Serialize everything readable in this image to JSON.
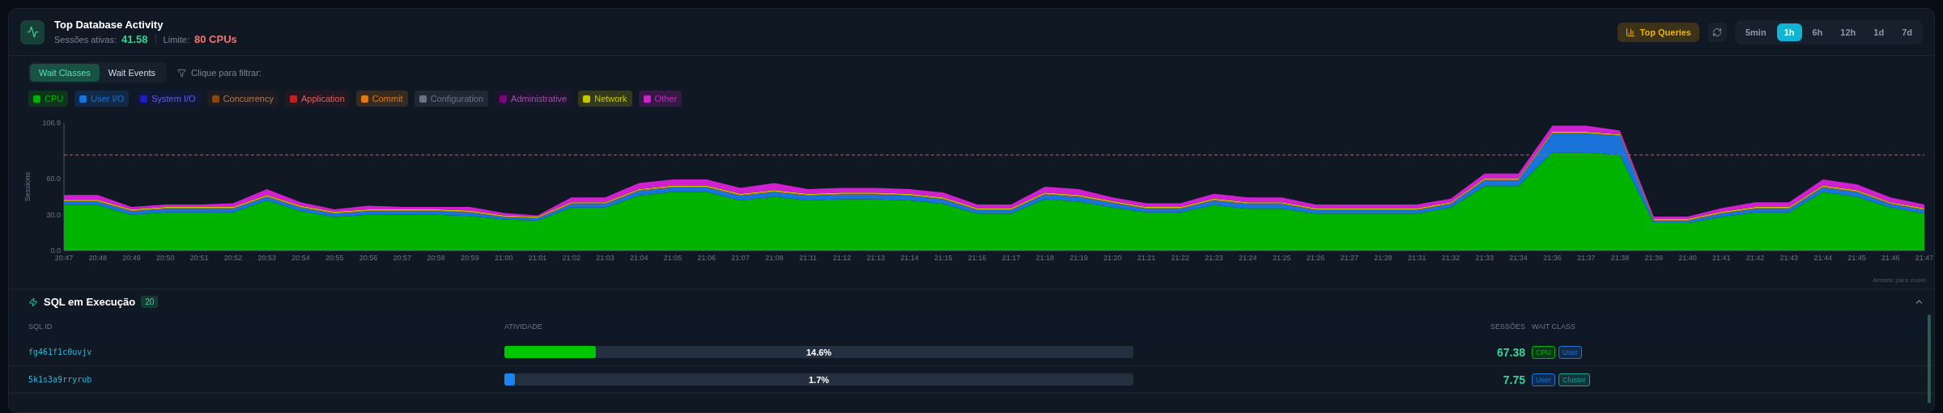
{
  "header": {
    "title": "Top Database Activity",
    "active_label": "Sessões ativas:",
    "active_value": "41.58",
    "limit_label": "Limite:",
    "limit_value": "80 CPUs"
  },
  "actions": {
    "top_queries": "Top Queries"
  },
  "ranges": [
    {
      "label": "5min",
      "selected": false
    },
    {
      "label": "1h",
      "selected": true
    },
    {
      "label": "6h",
      "selected": false
    },
    {
      "label": "12h",
      "selected": false
    },
    {
      "label": "1d",
      "selected": false
    },
    {
      "label": "7d",
      "selected": false
    }
  ],
  "view_tabs": [
    {
      "label": "Wait Classes",
      "selected": true
    },
    {
      "label": "Wait Events",
      "selected": false
    }
  ],
  "filter_hint": "Clique para filtrar:",
  "legend": [
    {
      "kind": "series",
      "selected": true
    },
    {
      "kind": "series",
      "selected": true
    },
    {
      "kind": "class",
      "label": "System I/O",
      "color": "#1c1ccc",
      "selected": false
    },
    {
      "kind": "class",
      "label": "Concurrency",
      "color": "#8b4513",
      "selected": false
    },
    {
      "kind": "class",
      "label": "Application",
      "color": "#c02020",
      "selected": false
    },
    {
      "kind": "series",
      "selected": true
    },
    {
      "kind": "class",
      "label": "Configuration",
      "color": "#6b7280",
      "selected": true
    },
    {
      "kind": "class",
      "label": "Administrative",
      "color": "#800080",
      "selected": false
    },
    {
      "kind": "series",
      "selected": true
    },
    {
      "kind": "series",
      "selected": true
    }
  ],
  "chart": {
    "hint": "Arraste para zoom",
    "chart_data": {
      "type": "area",
      "stacked": true,
      "ylabel": "Sessions",
      "ylim": [
        0,
        106.9
      ],
      "yticks": [
        {
          "value": 0,
          "label": "0.0"
        },
        {
          "value": 30,
          "label": "30.0"
        },
        {
          "value": 60,
          "label": "60.0"
        },
        {
          "value": 106.9,
          "label": "106.9"
        }
      ],
      "categories": [
        "20:47",
        "20:48",
        "20:49",
        "20:50",
        "20:51",
        "20:52",
        "20:53",
        "20:54",
        "20:55",
        "20:56",
        "20:57",
        "20:58",
        "20:59",
        "21:00",
        "21:01",
        "21:02",
        "21:03",
        "21:04",
        "21:05",
        "21:06",
        "21:07",
        "21:08",
        "21:11",
        "21:12",
        "21:13",
        "21:14",
        "21:15",
        "21:16",
        "21:17",
        "21:18",
        "21:19",
        "21:20",
        "21:21",
        "21:22",
        "21:23",
        "21:24",
        "21:25",
        "21:26",
        "21:27",
        "21:28",
        "21:31",
        "21:32",
        "21:33",
        "21:34",
        "21:36",
        "21:37",
        "21:38",
        "21:39",
        "21:40",
        "21:41",
        "21:42",
        "21:43",
        "21:44",
        "21:45",
        "21:46",
        "21:47"
      ],
      "series": [
        {
          "name": "CPU",
          "color": "#00b300",
          "values": [
            38,
            38,
            30,
            32,
            32,
            32,
            42,
            33,
            28,
            30,
            30,
            30,
            29,
            26,
            25,
            36,
            36,
            46,
            49,
            49,
            42,
            45,
            42,
            43,
            43,
            42,
            39,
            31,
            31,
            43,
            41,
            36,
            32,
            32,
            38,
            35,
            35,
            31,
            31,
            31,
            31,
            36,
            54,
            54,
            82,
            82,
            80,
            23,
            23,
            28,
            32,
            32,
            49,
            45,
            36,
            31
          ]
        },
        {
          "name": "User I/O",
          "color": "#1a73d9",
          "values": [
            3,
            3,
            3,
            3,
            3,
            3,
            3,
            3,
            3,
            3,
            3,
            3,
            3,
            2,
            2,
            3,
            3,
            4,
            4,
            4,
            4,
            4,
            4,
            4,
            4,
            4,
            4,
            3,
            3,
            4,
            4,
            4,
            3,
            3,
            4,
            4,
            4,
            3,
            3,
            3,
            3,
            3,
            5,
            5,
            16,
            16,
            16,
            2,
            2,
            3,
            3,
            3,
            4,
            4,
            3,
            3
          ]
        },
        {
          "name": "Commit",
          "color": "#e07a10",
          "values": [
            0.5,
            0.5,
            0.5,
            0.5,
            0.5,
            0.5,
            0.5,
            0.5,
            0.5,
            0.5,
            0.5,
            0.5,
            0.5,
            0.5,
            0.5,
            0.5,
            0.5,
            0.5,
            0.5,
            0.5,
            0.5,
            0.5,
            0.5,
            0.5,
            0.5,
            0.5,
            0.5,
            0.5,
            0.5,
            0.5,
            0.5,
            0.5,
            0.5,
            0.5,
            0.5,
            0.5,
            0.5,
            0.5,
            0.5,
            0.5,
            0.5,
            0.5,
            0.5,
            0.5,
            0.5,
            0.5,
            0.5,
            0.5,
            0.5,
            0.5,
            0.5,
            0.5,
            0.5,
            0.5,
            0.5,
            0.5
          ]
        },
        {
          "name": "Network",
          "color": "#c8c800",
          "values": [
            1,
            1,
            1,
            1,
            1,
            1,
            1,
            1,
            1,
            1,
            1,
            1,
            1,
            1,
            1,
            1,
            1,
            1,
            1,
            1,
            1,
            1,
            1,
            1,
            1,
            1,
            1,
            1,
            1,
            1,
            1,
            1,
            1,
            1,
            1,
            1,
            1,
            1,
            1,
            1,
            1,
            1,
            1,
            1,
            1,
            1,
            1,
            1,
            1,
            1,
            1,
            1,
            1,
            1,
            1,
            1
          ]
        },
        {
          "name": "Other",
          "color": "#d020d0",
          "values": [
            4,
            4,
            2,
            2,
            2,
            3,
            5,
            3,
            2,
            3,
            2,
            2,
            3,
            2,
            1,
            4,
            4,
            5,
            5,
            5,
            5,
            6,
            4,
            4,
            4,
            4,
            4,
            3,
            3,
            5,
            5,
            3,
            3,
            3,
            4,
            4,
            4,
            3,
            3,
            3,
            3,
            3,
            4,
            4,
            5,
            5,
            3,
            2,
            2,
            3,
            4,
            4,
            5,
            5,
            4,
            3
          ]
        }
      ],
      "ref_lines": [
        {
          "axis": "y",
          "value": 80,
          "color": "#e05252"
        }
      ]
    }
  },
  "sql_section": {
    "title": "SQL em Execução",
    "count": "20",
    "expanded": true,
    "columns": [
      "SQL ID",
      "ATIVIDADE",
      "SESSÕES",
      "WAIT CLASS"
    ],
    "rows": [
      {
        "sql_id": "fg461f1c0uvjv",
        "level": 0.146,
        "color": "#00c800",
        "percent": "14.6%",
        "sessions": "67.38",
        "tags": [
          {
            "label": "CPU",
            "color": "#00b300"
          },
          {
            "label": "User",
            "color": "#1a73d9"
          }
        ]
      },
      {
        "sql_id": "5k1s3a9rryrub",
        "level": 0.017,
        "color": "#1a84f0",
        "percent": "1.7%",
        "sessions": "7.75",
        "tags": [
          {
            "label": "User",
            "color": "#1a73d9"
          },
          {
            "label": "Cluster",
            "color": "#14a38f"
          }
        ]
      }
    ]
  }
}
